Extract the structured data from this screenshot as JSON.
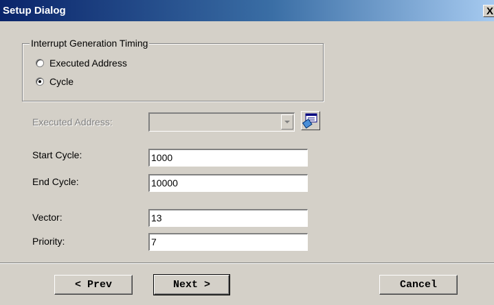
{
  "window": {
    "title": "Setup Dialog",
    "close_label": "X"
  },
  "timing_group": {
    "legend": "Interrupt Generation Timing",
    "options": [
      {
        "label": "Executed Address",
        "checked": false
      },
      {
        "label": "Cycle",
        "checked": true
      }
    ]
  },
  "fields": {
    "executed_address": {
      "label": "Executed Address:",
      "value": "",
      "disabled": true
    },
    "start_cycle": {
      "label": "Start Cycle:",
      "value": "1000"
    },
    "end_cycle": {
      "label": "End Cycle:",
      "value": "10000"
    },
    "vector": {
      "label": "Vector:",
      "value": "13"
    },
    "priority": {
      "label": "Priority:",
      "value": "7"
    }
  },
  "buttons": {
    "prev": "< Prev",
    "next": "Next >",
    "cancel": "Cancel"
  },
  "icons": {
    "browse": "browse-icon",
    "dropdown": "chevron-down-icon"
  }
}
